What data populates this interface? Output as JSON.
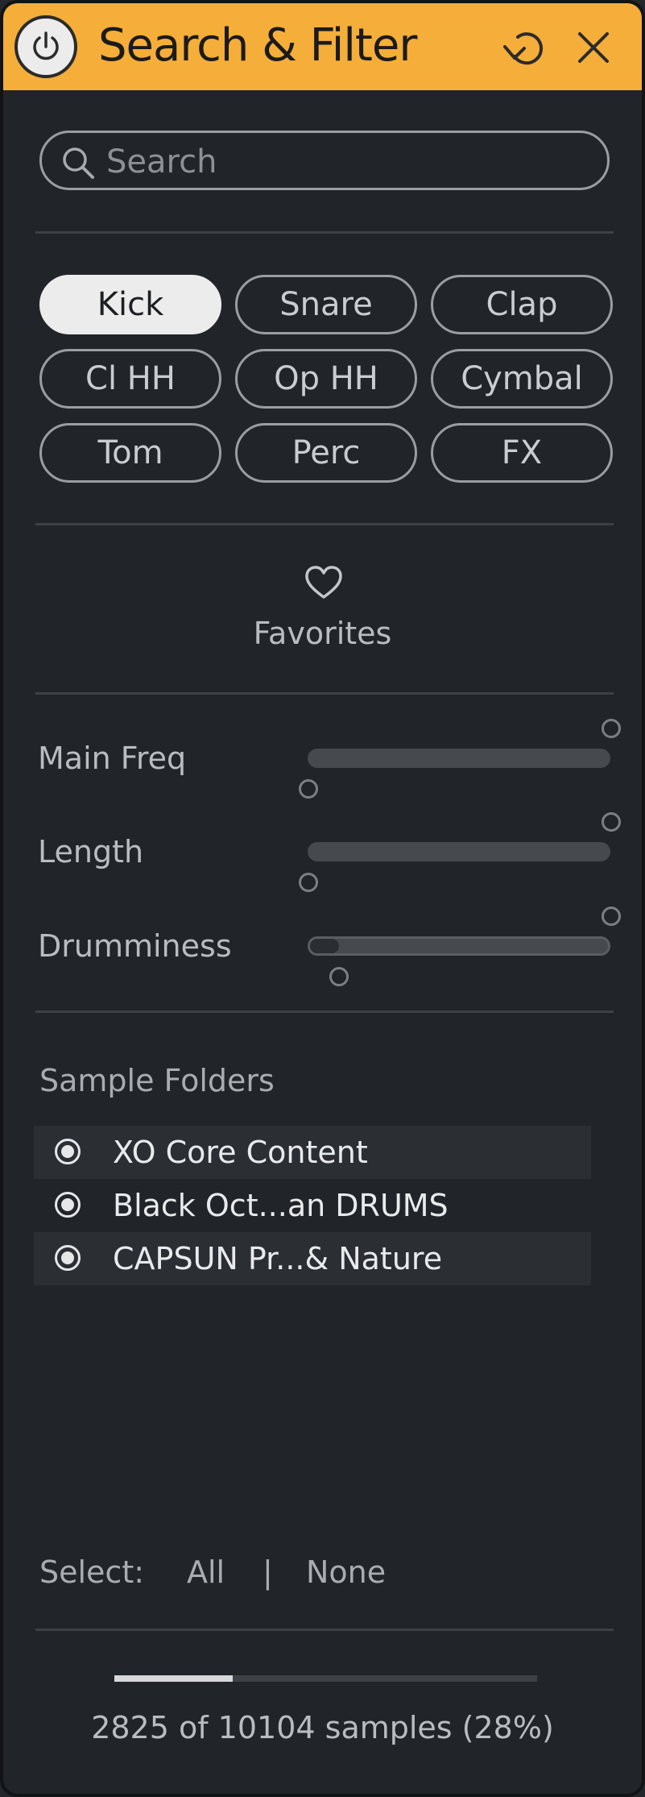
{
  "header": {
    "title": "Search & Filter",
    "power_icon": "power-icon",
    "reset_icon": "reset-icon",
    "close_icon": "close-icon",
    "accent_color": "#f5ae39"
  },
  "search": {
    "placeholder": "Search",
    "value": ""
  },
  "tags": [
    {
      "label": "Kick",
      "active": true
    },
    {
      "label": "Snare",
      "active": false
    },
    {
      "label": "Clap",
      "active": false
    },
    {
      "label": "Cl HH",
      "active": false
    },
    {
      "label": "Op HH",
      "active": false
    },
    {
      "label": "Cymbal",
      "active": false
    },
    {
      "label": "Tom",
      "active": false
    },
    {
      "label": "Perc",
      "active": false
    },
    {
      "label": "FX",
      "active": false
    }
  ],
  "favorites": {
    "label": "Favorites",
    "icon": "heart-icon"
  },
  "sliders": [
    {
      "label": "Main Freq",
      "range_min": 0,
      "range_max": 1
    },
    {
      "label": "Length",
      "range_min": 0,
      "range_max": 1
    },
    {
      "label": "Drumminess",
      "range_min": 0.1,
      "range_max": 1
    }
  ],
  "sample_folders": {
    "title": "Sample Folders",
    "items": [
      {
        "label": "XO Core Content",
        "selected": true
      },
      {
        "label": "Black Oct...an DRUMS",
        "selected": true
      },
      {
        "label": "CAPSUN Pr...& Nature",
        "selected": true
      }
    ]
  },
  "select": {
    "label": "Select:",
    "all": "All",
    "separator": "|",
    "none": "None"
  },
  "status": {
    "progress": 0.28,
    "text": "2825 of 10104 samples (28%)"
  }
}
